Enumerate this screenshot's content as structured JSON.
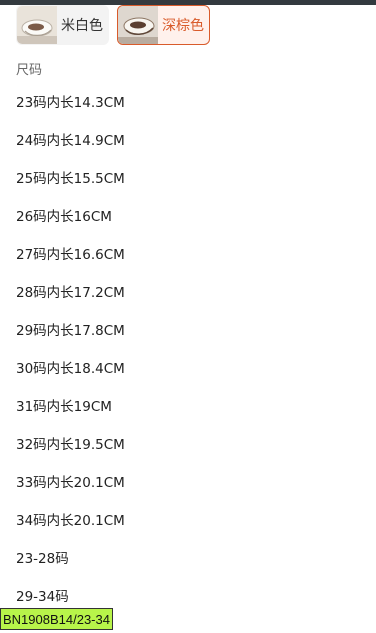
{
  "colors": {
    "options": [
      {
        "label": "米白色",
        "selected": false,
        "swatch_color": "#efeae2"
      },
      {
        "label": "深棕色",
        "selected": true,
        "swatch_color": "#6d4e3b"
      }
    ],
    "accent_color": "#d95b2b"
  },
  "sizes": {
    "title": "尺码",
    "items": [
      "23码内长14.3CM",
      "24码内长14.9CM",
      "25码内长15.5CM",
      "26码内长16CM",
      "27码内长16.6CM",
      "28码内长17.2CM",
      "29码内长17.8CM",
      "30码内长18.4CM",
      "31码内长19CM",
      "32码内长19.5CM",
      "33码内长20.1CM",
      "34码内长20.1CM",
      "23-28码",
      "29-34码"
    ]
  },
  "product_code": "BN1908B14/23-34"
}
